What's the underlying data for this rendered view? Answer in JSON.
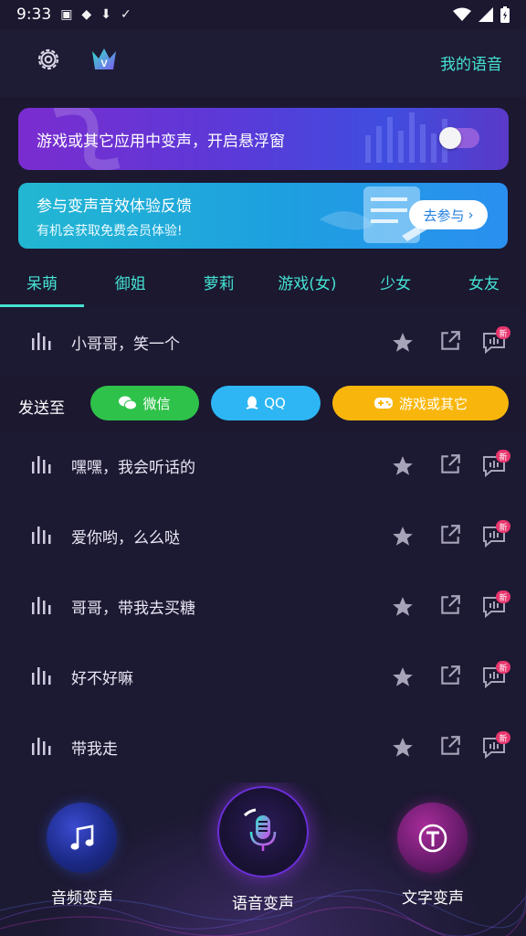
{
  "status_bar": {
    "time": "9:33"
  },
  "header": {
    "my_voice": "我的语音"
  },
  "floating_banner": {
    "text": "游戏或其它应用中变声，开启悬浮窗",
    "toggle_on": false
  },
  "feedback_banner": {
    "title": "参与变声音效体验反馈",
    "subtitle": "有机会获取免费会员体验!",
    "button": "去参与"
  },
  "tabs": [
    {
      "label": "呆萌",
      "active": true
    },
    {
      "label": "御姐",
      "active": false
    },
    {
      "label": "萝莉",
      "active": false
    },
    {
      "label": "游戏(女)",
      "active": false
    },
    {
      "label": "少女",
      "active": false
    },
    {
      "label": "女友",
      "active": false
    }
  ],
  "send_bar": {
    "label": "发送至",
    "wechat": "微信",
    "qq": "QQ",
    "game": "游戏或其它"
  },
  "voice_items": [
    {
      "label": "小哥哥，笑一个",
      "badge": "新"
    },
    {
      "label": "嘿嘿，我会听话的",
      "badge": "新"
    },
    {
      "label": "爱你哟，么么哒",
      "badge": "新"
    },
    {
      "label": "哥哥，带我去买糖",
      "badge": "新"
    },
    {
      "label": "好不好嘛",
      "badge": "新"
    },
    {
      "label": "带我走",
      "badge": "新"
    }
  ],
  "bottom_nav": {
    "audio": "音频变声",
    "voice": "语音变声",
    "text": "文字变声"
  },
  "colors": {
    "accent": "#45e3d3",
    "background": "#1b1830",
    "wechat": "#2fc24a",
    "qq": "#2db6f3",
    "game": "#f8b60c",
    "badge": "#e8356d"
  }
}
